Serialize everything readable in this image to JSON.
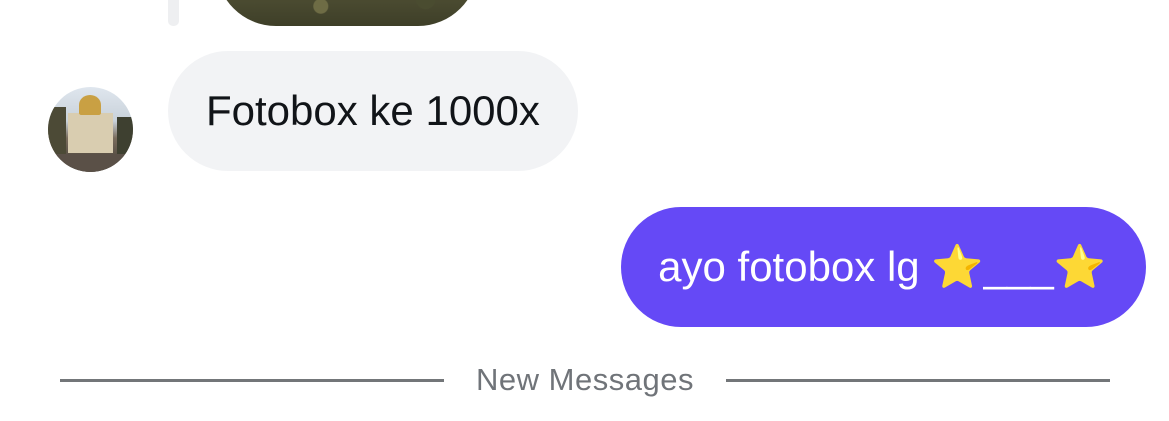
{
  "previous_message": {
    "media": "photo-thumbnail"
  },
  "incoming_message": {
    "avatar": "user-avatar-photo",
    "text": "Fotobox ke 1000x"
  },
  "outgoing_message": {
    "text": "ayo fotobox lg ⭐___⭐",
    "bubble_color": "#6549f6"
  },
  "divider": {
    "label": "New Messages"
  },
  "colors": {
    "incoming_bubble": "#f2f3f5",
    "outgoing_bubble": "#6549f6",
    "divider_line": "#737679",
    "divider_text": "#707479"
  }
}
